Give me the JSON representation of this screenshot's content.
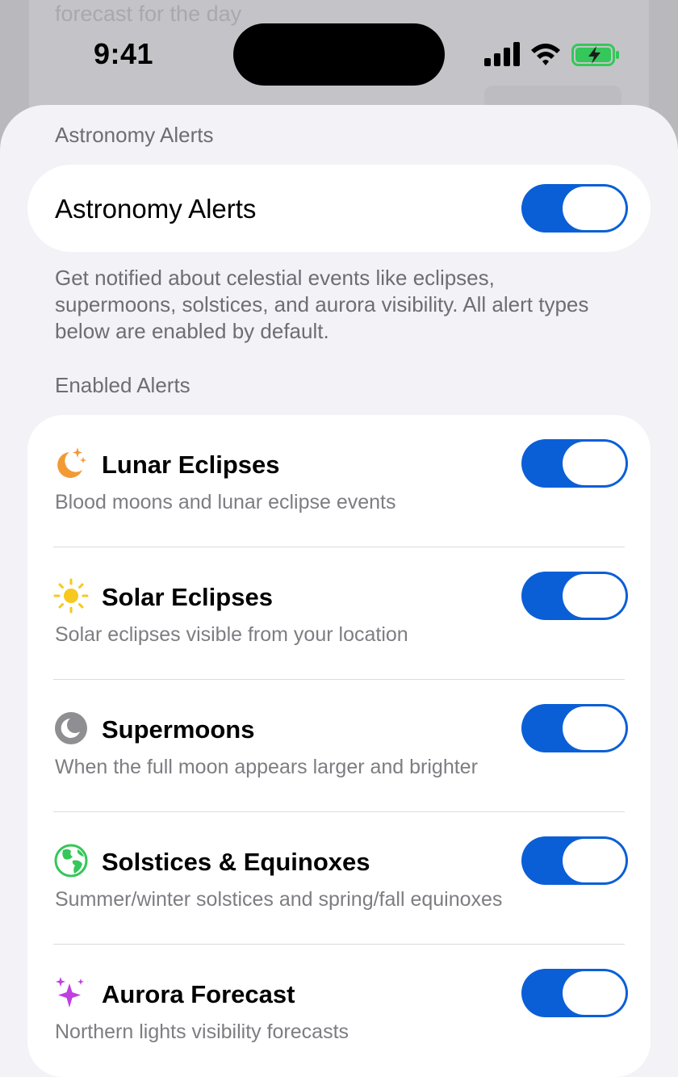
{
  "background": {
    "peek_text": "forecast for the day"
  },
  "status_bar": {
    "time": "9:41"
  },
  "sheet": {
    "section_title": "Astronomy Alerts",
    "master": {
      "label": "Astronomy Alerts",
      "enabled": true
    },
    "description": "Get notified about celestial events like eclipses, supermoons, solstices, and aurora visibility. All alert types below are enabled by default.",
    "enabled_header": "Enabled Alerts",
    "alerts": [
      {
        "icon": "moon-stars-icon",
        "title": "Lunar Eclipses",
        "subtitle": "Blood moons and lunar eclipse events",
        "enabled": true
      },
      {
        "icon": "sun-icon",
        "title": "Solar Eclipses",
        "subtitle": "Solar eclipses visible from your location",
        "enabled": true
      },
      {
        "icon": "moon-circle-icon",
        "title": "Supermoons",
        "subtitle": "When the full moon appears larger and brighter",
        "enabled": true
      },
      {
        "icon": "globe-icon",
        "title": "Solstices & Equinoxes",
        "subtitle": "Summer/winter solstices and spring/fall equinoxes",
        "enabled": true
      },
      {
        "icon": "sparkles-icon",
        "title": "Aurora Forecast",
        "subtitle": "Northern lights visibility forecasts",
        "enabled": true
      }
    ]
  },
  "colors": {
    "toggle_on": "#0a5fd6",
    "moon_orange": "#f39a35",
    "sun_yellow": "#f7c81e",
    "moon_gray": "#8e8e93",
    "globe_green": "#34c759",
    "sparkle_purple": "#c03fe0",
    "battery_green": "#34c759"
  }
}
